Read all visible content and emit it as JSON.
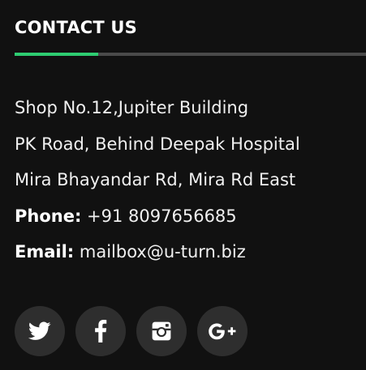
{
  "heading": "CONTACT US",
  "accent_color": "#2ecc71",
  "address": {
    "line1": "Shop No.12,Jupiter Building",
    "line2": "PK Road, Behind Deepak Hospital",
    "line3": "Mira Bhayandar Rd, Mira Rd East",
    "phone_label": "Phone:",
    "phone_value": "+91 8097656685",
    "email_label": "Email:",
    "email_value": "mailbox@u-turn.biz"
  },
  "social": [
    {
      "icon": "twitter-icon"
    },
    {
      "icon": "facebook-icon"
    },
    {
      "icon": "instagram-icon"
    },
    {
      "icon": "google-plus-icon"
    }
  ]
}
